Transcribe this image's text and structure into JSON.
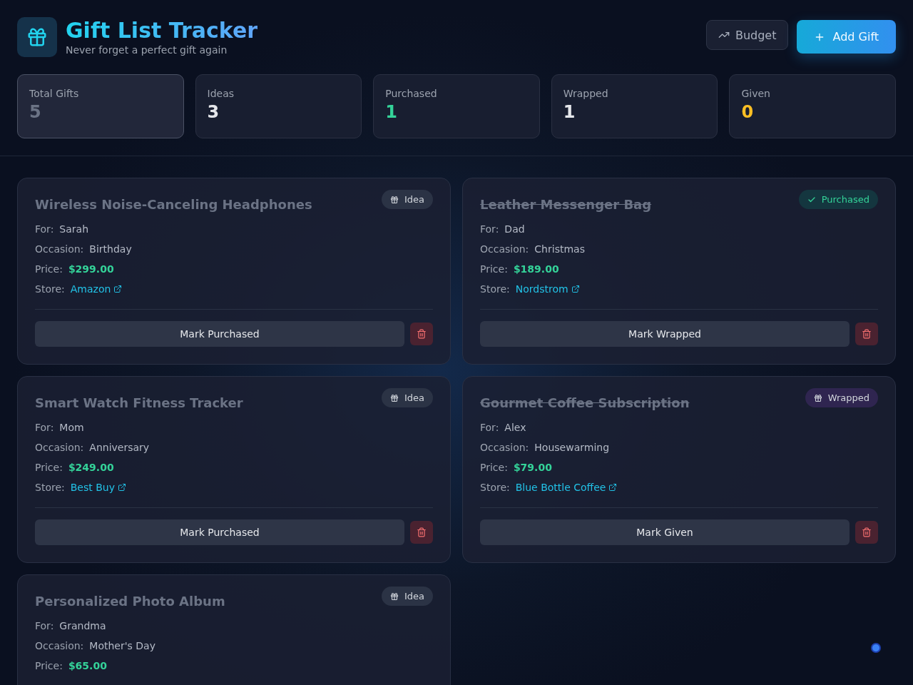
{
  "header": {
    "title": "Gift List Tracker",
    "subtitle": "Never forget a perfect gift again",
    "buttons": [
      {
        "kind": "budget",
        "label": "Budget"
      },
      {
        "kind": "add",
        "label": "Add Gift"
      }
    ]
  },
  "stats": [
    {
      "label": "Total Gifts",
      "value": "5",
      "color": "#6b7385",
      "selected": true
    },
    {
      "label": "Ideas",
      "value": "3",
      "color": "#e5e7eb",
      "selected": false
    },
    {
      "label": "Purchased",
      "value": "1",
      "color": "#34d399",
      "selected": false
    },
    {
      "label": "Wrapped",
      "value": "1",
      "color": "#e5e7eb",
      "selected": false
    },
    {
      "label": "Given",
      "value": "0",
      "color": "#fbbf24",
      "selected": false
    }
  ],
  "gifts": [
    {
      "title": "Wireless Noise-Canceling Headphones",
      "kind": "idea",
      "badge": "Idea",
      "details": [
        {
          "label": "For:",
          "value": "Sarah",
          "kind": "text"
        },
        {
          "label": "Occasion:",
          "value": "Birthday",
          "kind": "text"
        },
        {
          "label": "Price:",
          "value": "$299.00",
          "kind": "price"
        },
        {
          "label": "Store:",
          "value": "Amazon",
          "kind": "link"
        }
      ],
      "action": "Mark Purchased"
    },
    {
      "title": "Leather Messenger Bag",
      "kind": "purchased",
      "badge": "Purchased",
      "details": [
        {
          "label": "For:",
          "value": "Dad",
          "kind": "text"
        },
        {
          "label": "Occasion:",
          "value": "Christmas",
          "kind": "text"
        },
        {
          "label": "Price:",
          "value": "$189.00",
          "kind": "price"
        },
        {
          "label": "Store:",
          "value": "Nordstrom",
          "kind": "link"
        }
      ],
      "action": "Mark Wrapped"
    },
    {
      "title": "Smart Watch Fitness Tracker",
      "kind": "idea",
      "badge": "Idea",
      "details": [
        {
          "label": "For:",
          "value": "Mom",
          "kind": "text"
        },
        {
          "label": "Occasion:",
          "value": "Anniversary",
          "kind": "text"
        },
        {
          "label": "Price:",
          "value": "$249.00",
          "kind": "price"
        },
        {
          "label": "Store:",
          "value": "Best Buy",
          "kind": "link"
        }
      ],
      "action": "Mark Purchased"
    },
    {
      "title": "Gourmet Coffee Subscription",
      "kind": "wrapped",
      "badge": "Wrapped",
      "details": [
        {
          "label": "For:",
          "value": "Alex",
          "kind": "text"
        },
        {
          "label": "Occasion:",
          "value": "Housewarming",
          "kind": "text"
        },
        {
          "label": "Price:",
          "value": "$79.00",
          "kind": "price"
        },
        {
          "label": "Store:",
          "value": "Blue Bottle Coffee",
          "kind": "link"
        }
      ],
      "action": "Mark Given"
    },
    {
      "title": "Personalized Photo Album",
      "kind": "idea",
      "badge": "Idea",
      "details": [
        {
          "label": "For:",
          "value": "Grandma",
          "kind": "text"
        },
        {
          "label": "Occasion:",
          "value": "Mother's Day",
          "kind": "text"
        },
        {
          "label": "Price:",
          "value": "$65.00",
          "kind": "price"
        }
      ]
    }
  ]
}
